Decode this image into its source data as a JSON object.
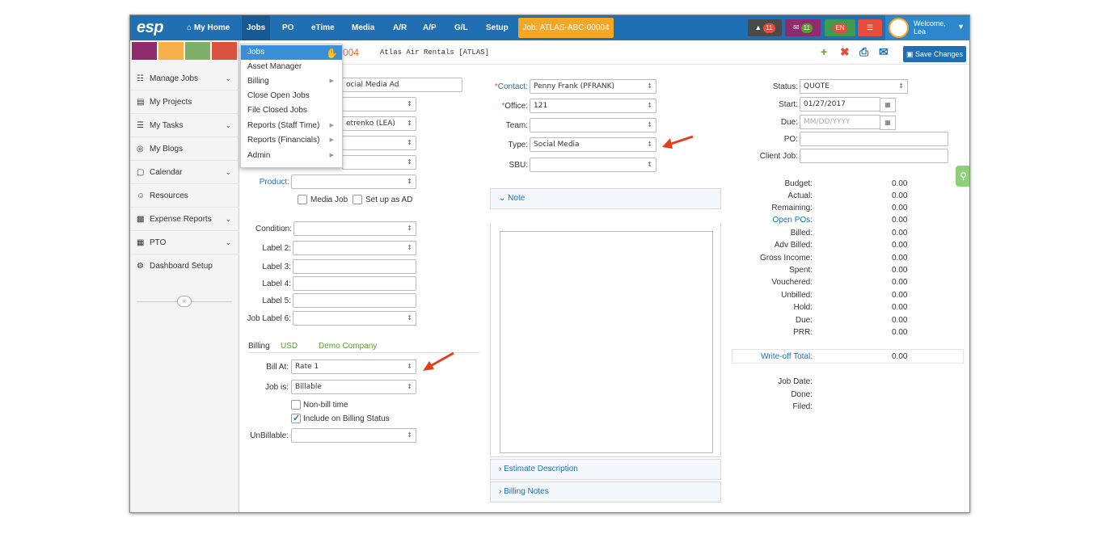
{
  "topbar": {
    "logo": "esp",
    "nav": [
      "My Home",
      "Jobs",
      "PO",
      "eTime",
      "Media",
      "A/R",
      "A/P",
      "G/L",
      "Setup"
    ],
    "job_badge": "Job: ATLAS-ABC-00004",
    "notifications_count": "11",
    "messages_count": "11",
    "language": "EN",
    "welcome": "Welcome,",
    "user": "Lea"
  },
  "swatches": [
    "#8e2c6e",
    "#f8b04a",
    "#7fb069",
    "#d9533f"
  ],
  "sidebar": {
    "items": [
      {
        "label": "Manage Jobs",
        "icon": "sitemap-icon",
        "chevron": true
      },
      {
        "label": "My Projects",
        "icon": "folder-icon",
        "chevron": false
      },
      {
        "label": "My Tasks",
        "icon": "tasks-icon",
        "chevron": true
      },
      {
        "label": "My Blogs",
        "icon": "blog-icon",
        "chevron": false
      },
      {
        "label": "Calendar",
        "icon": "calendar-icon",
        "chevron": true
      },
      {
        "label": "Resources",
        "icon": "users-icon",
        "chevron": false
      },
      {
        "label": "Expense Reports",
        "icon": "money-icon",
        "chevron": true
      },
      {
        "label": "PTO",
        "icon": "calendar-grid-icon",
        "chevron": true
      },
      {
        "label": "Dashboard Setup",
        "icon": "cogs-icon",
        "chevron": false
      }
    ],
    "collapse_glyph": "«"
  },
  "subbar": {
    "job_number_suffix": "004",
    "client": "Atlas Air Rentals [ATLAS]",
    "save_label": "Save Changes"
  },
  "jobs_menu": {
    "items": [
      {
        "label": "Jobs",
        "submenu": false
      },
      {
        "label": "Asset Manager",
        "submenu": false
      },
      {
        "label": "Billing",
        "submenu": true
      },
      {
        "label": "Close Open Jobs",
        "submenu": false
      },
      {
        "label": "File Closed Jobs",
        "submenu": false
      },
      {
        "label": "Reports (Staff Time)",
        "submenu": true
      },
      {
        "label": "Reports (Financials)",
        "submenu": true
      },
      {
        "label": "Admin",
        "submenu": true
      }
    ]
  },
  "form_left": {
    "title_value": "ocial Media Ad",
    "row2_value": "",
    "row3_value": "etrenko (LEA)",
    "product_label": "Product:",
    "media_job_label": "Media Job",
    "setup_ad_label": "Set up as AD",
    "condition_label": "Condition:",
    "label2": "Label 2:",
    "label3": "Label 3:",
    "label4": "Label 4:",
    "label5": "Label 5:",
    "label6": "Job Label 6:",
    "billing_title": "Billing",
    "currency": "USD",
    "company": "Demo Company",
    "bill_at_label": "Bill At:",
    "bill_at_value": "Rate 1",
    "job_is_label": "Job is:",
    "job_is_value": "Billable",
    "nonbill_label": "Non-bill time",
    "include_label": "Include on Billing Status",
    "unbillable_label": "UnBillable:"
  },
  "form_mid": {
    "contact_label": "Contact:",
    "contact_value": "Penny Frank (PFRANK)",
    "office_label": "Office:",
    "office_value": "121",
    "team_label": "Team:",
    "type_label": "Type:",
    "type_value": "Social Media",
    "sbu_label": "SBU:",
    "note_title": "Note",
    "estimate_title": "Estimate Description",
    "billing_notes_title": "Billing Notes",
    "collapsed_glyph": "›",
    "expanded_glyph": "⌄"
  },
  "form_right": {
    "status_label": "Status:",
    "status_value": "QUOTE",
    "start_label": "Start:",
    "start_value": "01/27/2017",
    "due_label": "Due:",
    "due_placeholder": "MM/DD/YYYY",
    "po_label": "PO:",
    "client_job_label": "Client Job:",
    "financials": [
      {
        "label": "Budget:",
        "value": "0.00"
      },
      {
        "label": "Actual:",
        "value": "0.00"
      },
      {
        "label": "Remaining:",
        "value": "0.00"
      },
      {
        "label": "Open POs:",
        "value": "0.00",
        "link": true
      },
      {
        "label": "Billed:",
        "value": "0.00"
      },
      {
        "label": "Adv Billed:",
        "value": "0.00"
      },
      {
        "label": "Gross Income:",
        "value": "0.00"
      },
      {
        "label": "Spent:",
        "value": "0.00"
      },
      {
        "label": "Vouchered:",
        "value": "0.00"
      },
      {
        "label": "Unbilled:",
        "value": "0.00"
      },
      {
        "label": "Hold:",
        "value": "0.00"
      },
      {
        "label": "Due:",
        "value": "0.00"
      },
      {
        "label": "PRR:",
        "value": "0.00"
      }
    ],
    "writeoff_label": "Write-off Total:",
    "writeoff_value": "0.00",
    "job_date_label": "Job Date:",
    "done_label": "Done:",
    "filed_label": "Filed:"
  }
}
